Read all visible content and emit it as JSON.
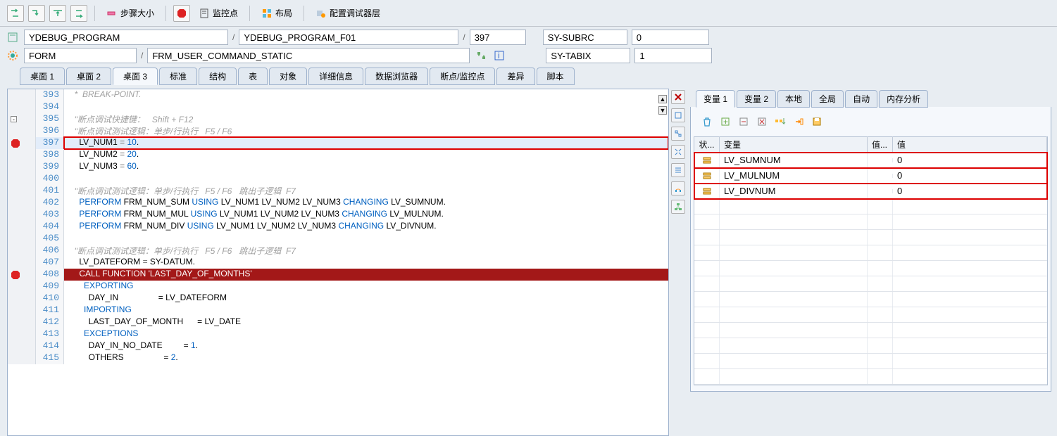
{
  "toolbar": {
    "step_size": "步骤大小",
    "watchpoint": "监控点",
    "layout": "布局",
    "config_debug_layer": "配置调试器层"
  },
  "context": {
    "program": "YDEBUG_PROGRAM",
    "include": "YDEBUG_PROGRAM_F01",
    "line": "397",
    "block_type": "FORM",
    "block_name": "FRM_USER_COMMAND_STATIC",
    "var1_label": "SY-SUBRC",
    "var1_value": "0",
    "var2_label": "SY-TABIX",
    "var2_value": "1",
    "sep": "/"
  },
  "tabs": [
    "桌面 1",
    "桌面 2",
    "桌面 3",
    "标准",
    "结构",
    "表",
    "对象",
    "详细信息",
    "数据浏览器",
    "断点/监控点",
    "差异",
    "脚本"
  ],
  "tabs_active": 2,
  "code_start_line": 393,
  "code_lines": [
    {
      "n": 393,
      "type": "comment",
      "text": "*  BREAK-POINT."
    },
    {
      "n": 394,
      "type": "blank",
      "text": ""
    },
    {
      "n": 395,
      "type": "comment",
      "text": "\"断点调试快捷键：   Shift + F12",
      "fold": "open"
    },
    {
      "n": 396,
      "type": "comment",
      "text": "\"断点调试测试逻辑：单步/行执行   F5 / F6"
    },
    {
      "n": 397,
      "type": "assign",
      "var": "LV_NUM1",
      "op": "=",
      "val": "10",
      "mark": "current",
      "bp": true
    },
    {
      "n": 398,
      "type": "assign",
      "var": "LV_NUM2",
      "op": "=",
      "val": "20"
    },
    {
      "n": 399,
      "type": "assign",
      "var": "LV_NUM3",
      "op": "=",
      "val": "60"
    },
    {
      "n": 400,
      "type": "blank",
      "text": ""
    },
    {
      "n": 401,
      "type": "comment",
      "text": "\"断点调试测试逻辑：单步/行执行   F5 / F6   跳出子逻辑  F7"
    },
    {
      "n": 402,
      "type": "perform",
      "fn": "FRM_NUM_SUM",
      "using": "LV_NUM1 LV_NUM2 LV_NUM3",
      "changing": "LV_SUMNUM"
    },
    {
      "n": 403,
      "type": "perform",
      "fn": "FRM_NUM_MUL",
      "using": "LV_NUM1 LV_NUM2 LV_NUM3",
      "changing": "LV_MULNUM"
    },
    {
      "n": 404,
      "type": "perform",
      "fn": "FRM_NUM_DIV",
      "using": "LV_NUM1 LV_NUM2 LV_NUM3",
      "changing": "LV_DIVNUM"
    },
    {
      "n": 405,
      "type": "blank",
      "text": ""
    },
    {
      "n": 406,
      "type": "comment",
      "text": "\"断点调试测试逻辑：单步/行执行   F5 / F6   跳出子逻辑  F7"
    },
    {
      "n": 407,
      "type": "assign",
      "var": "LV_DATEFORM",
      "op": "=",
      "val": "SY-DATUM",
      "val_is_id": true
    },
    {
      "n": 408,
      "type": "bpcall",
      "text1": "CALL FUNCTION",
      "text2": "'LAST_DAY_OF_MONTHS'",
      "bp": true
    },
    {
      "n": 409,
      "type": "section",
      "text": "EXPORTING"
    },
    {
      "n": 410,
      "type": "param",
      "name": "DAY_IN",
      "val": "LV_DATEFORM"
    },
    {
      "n": 411,
      "type": "section",
      "text": "IMPORTING"
    },
    {
      "n": 412,
      "type": "param",
      "name": "LAST_DAY_OF_MONTH",
      "val": "LV_DATE"
    },
    {
      "n": 413,
      "type": "section",
      "text": "EXCEPTIONS"
    },
    {
      "n": 414,
      "type": "param",
      "name": "DAY_IN_NO_DATE",
      "val": "1",
      "num": true
    },
    {
      "n": 415,
      "type": "param",
      "name": "OTHERS",
      "val": "2",
      "num": true
    }
  ],
  "var_tabs": [
    "变量 1",
    "变量 2",
    "本地",
    "全局",
    "自动",
    "内存分析"
  ],
  "var_tabs_active": 0,
  "var_headers": {
    "c1": "状...",
    "c2": "变量",
    "c3": "值...",
    "c4": "值"
  },
  "var_rows": [
    {
      "status_icon": "struct",
      "name": "LV_SUMNUM",
      "value": "0"
    },
    {
      "status_icon": "struct",
      "name": "LV_MULNUM",
      "value": "0"
    },
    {
      "status_icon": "struct",
      "name": "LV_DIVNUM",
      "value": "0"
    }
  ],
  "var_empty_rows": 12,
  "keywords": {
    "PERFORM": "PERFORM",
    "USING": "USING",
    "CHANGING": "CHANGING",
    "CALL": "CALL",
    "FUNCTION": "FUNCTION",
    "EXPORTING": "EXPORTING",
    "IMPORTING": "IMPORTING",
    "EXCEPTIONS": "EXCEPTIONS",
    "OTHERS": "OTHERS"
  }
}
